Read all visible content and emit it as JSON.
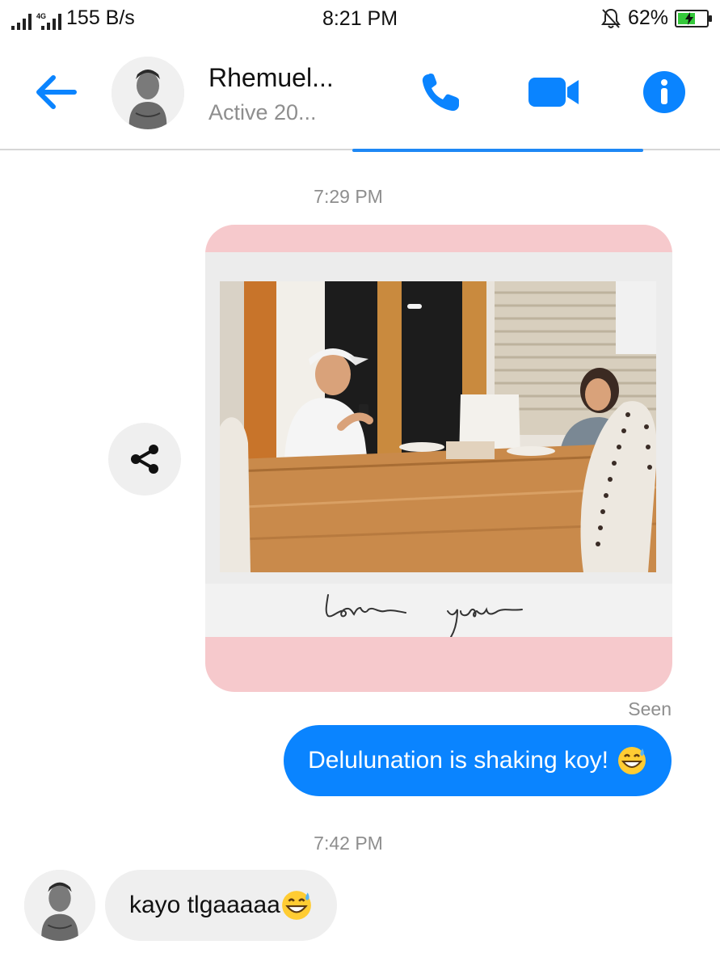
{
  "status_bar": {
    "network_type": "4G",
    "speed": "155 B/s",
    "time": "8:21 PM",
    "battery": "62%",
    "battery_level": 0.62,
    "icons": [
      "signal-icon",
      "mobile-data-icon",
      "bell-off-icon",
      "battery-charging-icon"
    ]
  },
  "header": {
    "contact_name": "Rhemuel...",
    "contact_status": "Active 20...",
    "icons": [
      "back-arrow-icon",
      "phone-icon",
      "video-camera-icon",
      "info-icon"
    ]
  },
  "conversation": {
    "timestamp_1": "7:29 PM",
    "photo_caption": "love you",
    "share_icon": "share-icon",
    "seen_label": "Seen",
    "outgoing_text": "Delulunation is shaking koy!",
    "outgoing_emoji": "grinning-sweat-emoji",
    "timestamp_2": "7:42 PM",
    "incoming_text": "kayo tlgaaaaa",
    "incoming_emoji": "grinning-sweat-emoji"
  },
  "colors": {
    "accent": "#0a84ff",
    "outgoing_bubble": "#0a84ff",
    "incoming_bubble": "#efefef",
    "photo_border": "#f6c9cc",
    "muted_text": "#8e8e8e"
  }
}
